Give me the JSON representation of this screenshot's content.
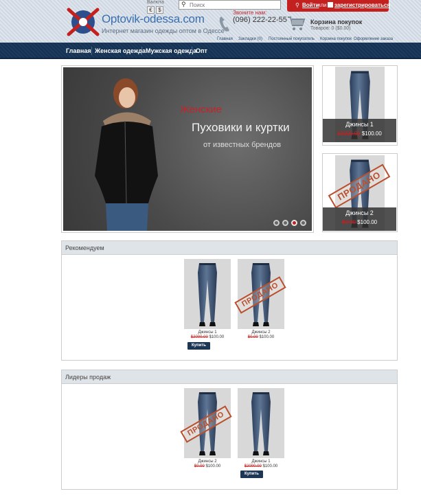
{
  "header": {
    "logo_text": "Optovik-odessa.com",
    "logo_tagline": "Интернет магазин одежды оптом в Одессе",
    "currency_label": "Валюта",
    "currency_buttons": [
      "€",
      "$"
    ],
    "search_placeholder": "Поиск",
    "call_label": "Звоните нам:",
    "phone": "(096) 222-22-55",
    "cart_title": "Корзина покупок",
    "cart_info": "Товаров: 0 ($0.00)",
    "auth": {
      "login": "Войти",
      "or": "или",
      "register": "зарегистрироваться"
    },
    "top_links": [
      "Главная",
      "Закладки (0)",
      "Постоянный покупатель",
      "Корзина покупок",
      "Оформление заказа"
    ]
  },
  "nav": {
    "items": [
      "Главная",
      "Женская одежда",
      "Мужская одежда",
      "Опт"
    ]
  },
  "slider": {
    "accent": "Женские",
    "title": "Пуховики и куртки",
    "subtitle": "от известных брендов",
    "dots": 4,
    "active_dot": 3
  },
  "side_products": [
    {
      "name": "Джинсы 1",
      "old_price": "$2000.00",
      "price": "$100.00",
      "sold": false
    },
    {
      "name": "Джинсы 2",
      "old_price": "$0.00",
      "price": "$100.00",
      "sold": true
    }
  ],
  "stamp_text": "ПРОДАНО",
  "sections": [
    {
      "title": "Рекомендуем",
      "products": [
        {
          "name": "Джинсы 1",
          "old_price": "$2000.00",
          "price": "$100.00",
          "sold": false,
          "buy": "Купить"
        },
        {
          "name": "Джинсы 2",
          "old_price": "$0.00",
          "price": "$100.00",
          "sold": true
        }
      ]
    },
    {
      "title": "Лидеры продаж",
      "products": [
        {
          "name": "Джинсы 2",
          "old_price": "$0.00",
          "price": "$100.00",
          "sold": true
        },
        {
          "name": "Джинсы 1",
          "old_price": "$2000.00",
          "price": "$100.00",
          "sold": false,
          "buy": "Купить"
        }
      ]
    }
  ],
  "colors": {
    "brand_red": "#c3211f",
    "nav_blue": "#1d3b5f",
    "logo_blue": "#3a6fb0"
  }
}
